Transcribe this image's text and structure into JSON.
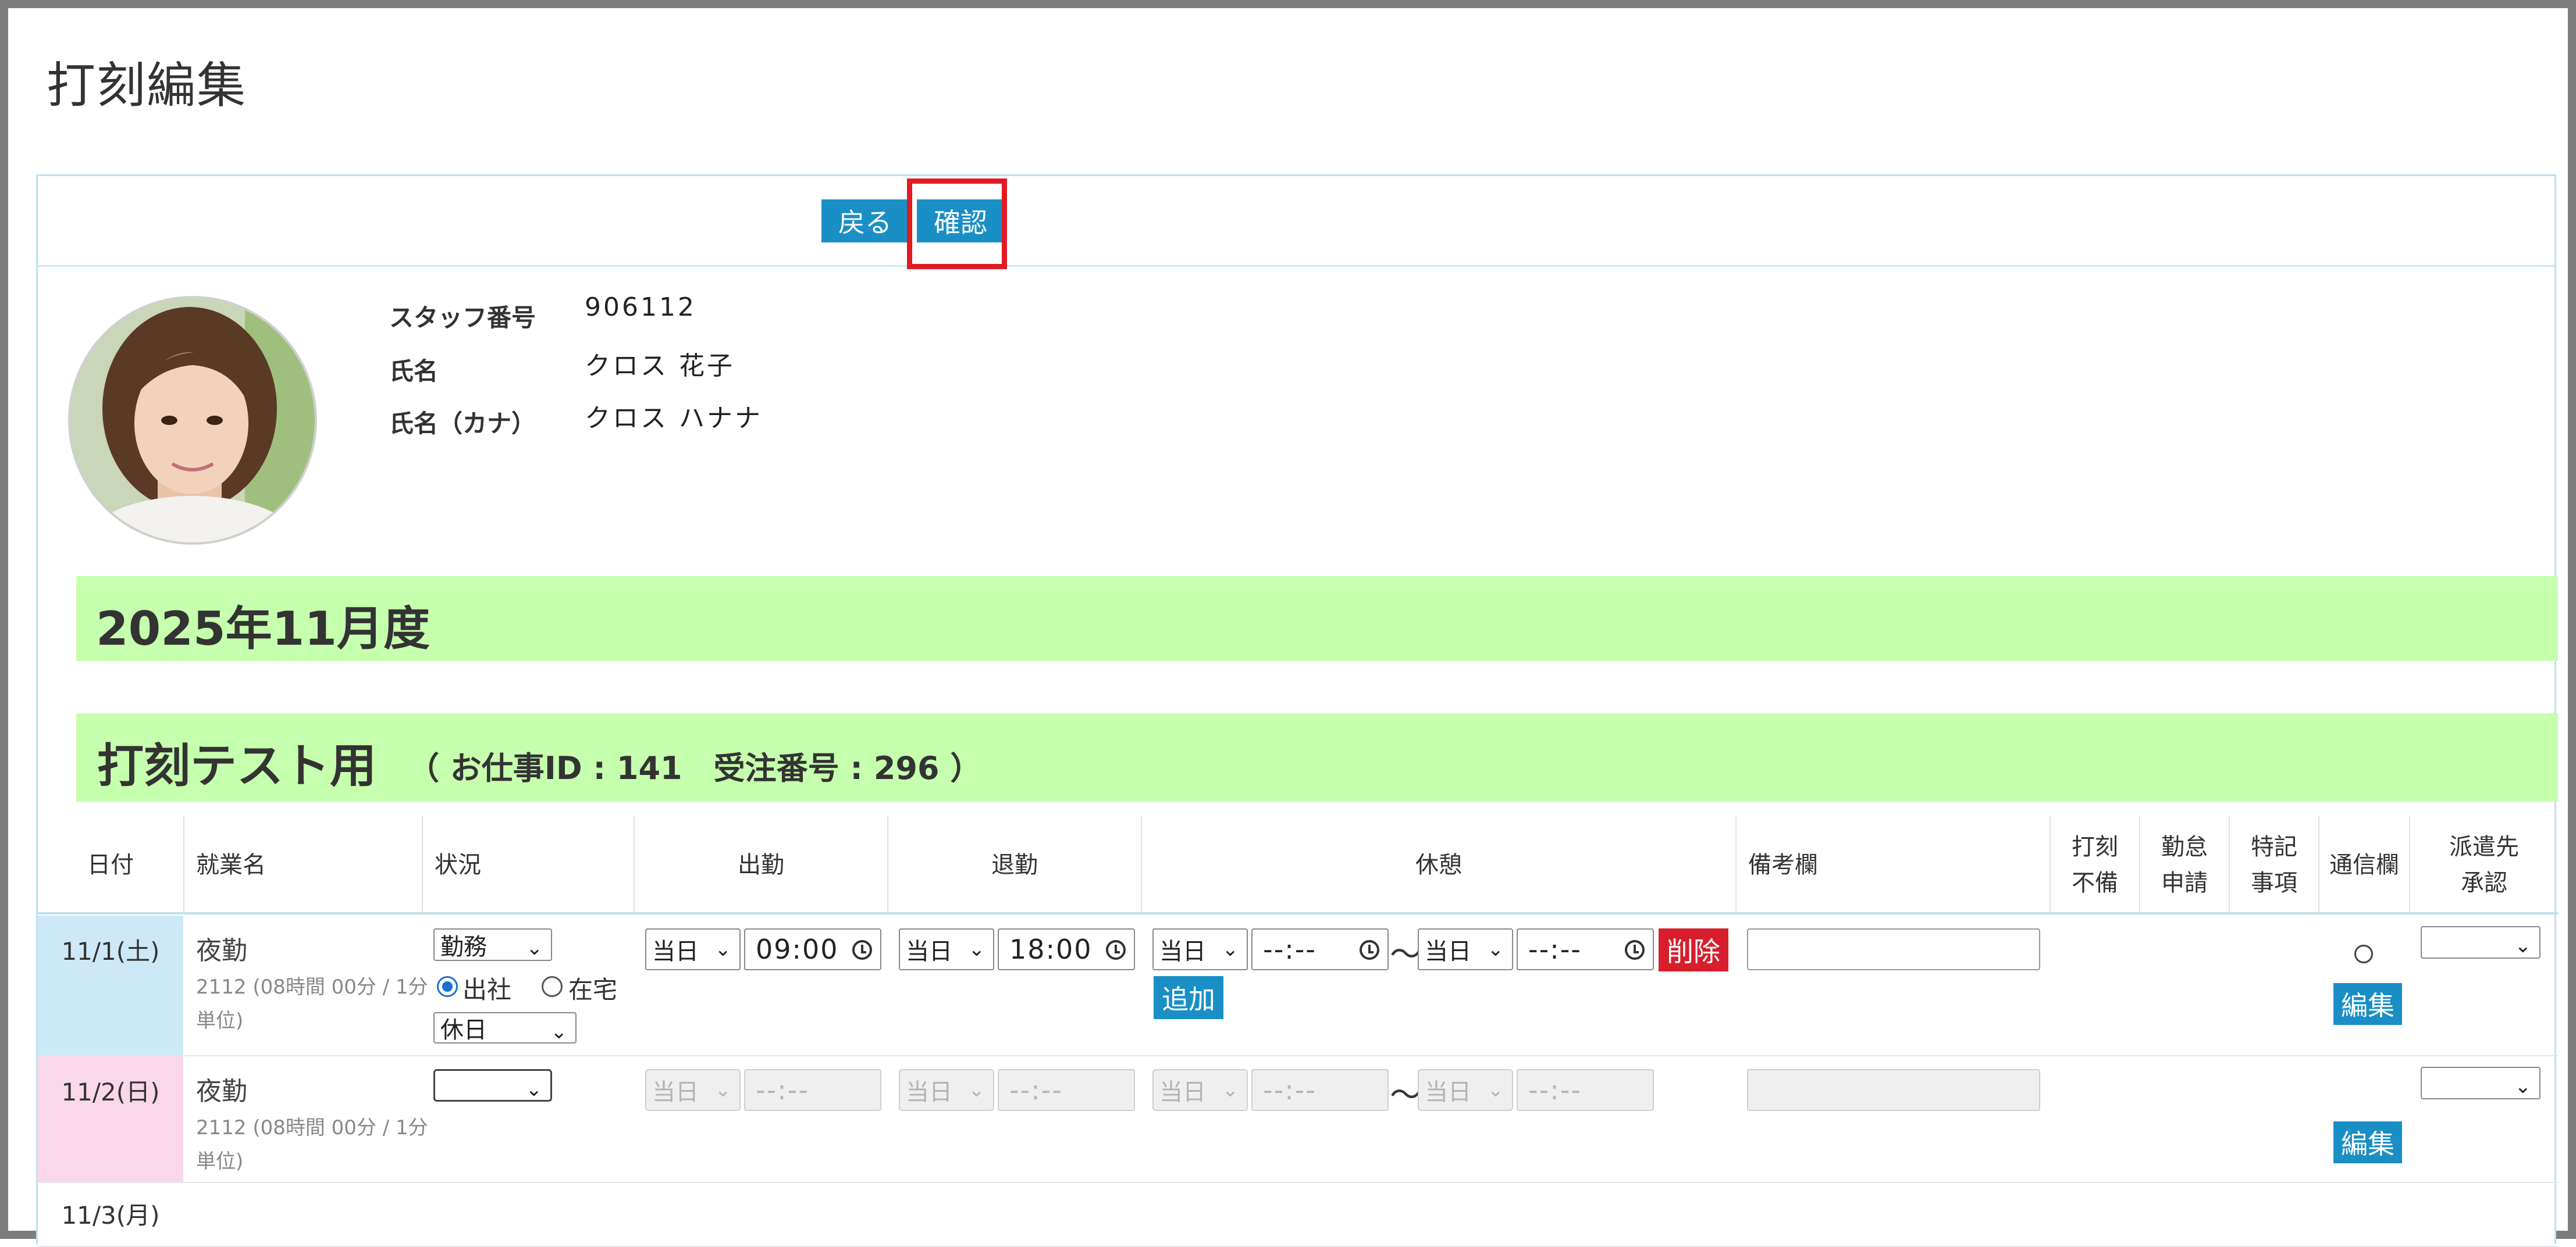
{
  "page": {
    "title": "打刻編集"
  },
  "toolbar": {
    "back_label": "戻る",
    "confirm_label": "確認"
  },
  "staff": {
    "number_label": "スタッフ番号",
    "number": "906112",
    "name_label": "氏名",
    "name": "クロス 花子",
    "kana_label": "氏名（カナ）",
    "kana": "クロス ハナナ"
  },
  "period": {
    "month_title": "2025年11月度"
  },
  "job": {
    "title": "打刻テスト用",
    "subtitle": "（ お仕事ID : 141　受注番号 : 296 ）"
  },
  "table": {
    "headers": {
      "date": "日付",
      "work_name": "就業名",
      "status": "状況",
      "clock_in": "出勤",
      "clock_out": "退勤",
      "break": "休憩",
      "remarks": "備考欄",
      "missing_1": "打刻",
      "missing_2": "不備",
      "attendance_1": "勤怠",
      "attendance_2": "申請",
      "special_1": "特記",
      "special_2": "事項",
      "comm": "通信欄",
      "approval_1": "派遣先",
      "approval_2": "承認"
    },
    "rows": [
      {
        "date": "11/1(土)",
        "work_name": "夜勤",
        "work_sub": "2112 (08時間 00分 / 1分単位)",
        "status": "勤務",
        "location_office": "出社",
        "location_home": "在宅",
        "holiday": "休日",
        "in_day": "当日",
        "in_time": "09:00",
        "out_day": "当日",
        "out_time": "18:00",
        "break_start_day": "当日",
        "break_start_time": "--:--",
        "break_end_day": "当日",
        "break_end_time": "--:--",
        "tilde": "〜",
        "delete_label": "削除",
        "add_label": "追加",
        "comm_mark": "○",
        "edit_label": "編集"
      },
      {
        "date": "11/2(日)",
        "work_name": "夜勤",
        "work_sub": "2112 (08時間 00分 / 1分単位)",
        "in_day": "当日",
        "in_time": "--:--",
        "out_day": "当日",
        "out_time": "--:--",
        "break_start_day": "当日",
        "break_start_time": "--:--",
        "break_end_day": "当日",
        "break_end_time": "--:--",
        "tilde": "〜",
        "edit_label": "編集"
      },
      {
        "date": "11/3(月)"
      }
    ]
  }
}
